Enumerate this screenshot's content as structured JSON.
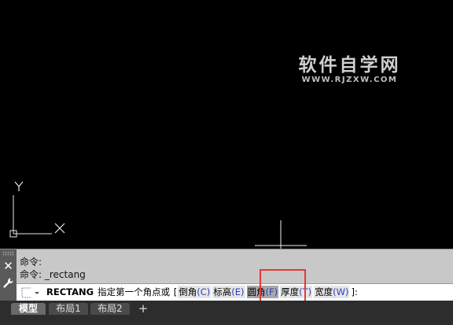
{
  "watermark": {
    "title": "软件自学网",
    "url": "WWW.RJZXW.COM"
  },
  "canvas": {
    "ucs_y_label": "Y",
    "ucs_x_label": "X"
  },
  "command_window": {
    "history": [
      "命令:",
      "命令: _rectang"
    ],
    "prompt": {
      "command": "RECTANG",
      "text": "指定第一个角点或",
      "open_bracket": "[",
      "close_bracket": "]:",
      "options": [
        {
          "label": "倒角",
          "key": "(C)"
        },
        {
          "label": "标高",
          "key": "(E)"
        },
        {
          "label": "圆角",
          "key": "(F)"
        },
        {
          "label": "厚度",
          "key": "(T)"
        },
        {
          "label": "宽度",
          "key": "(W)"
        }
      ]
    }
  },
  "tabs": {
    "items": [
      "模型",
      "布局1",
      "布局2"
    ],
    "add": "+"
  },
  "colors": {
    "highlight": "#e53935",
    "option_key": "#2a3fbf"
  }
}
